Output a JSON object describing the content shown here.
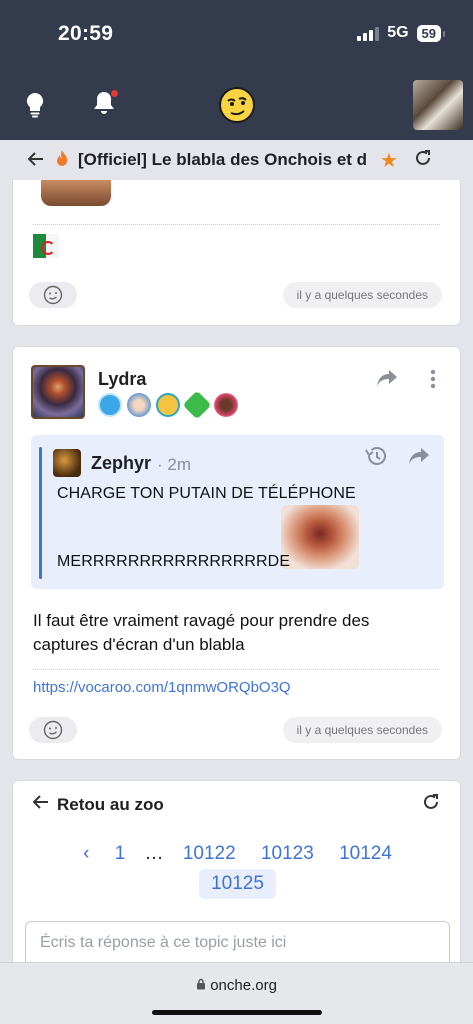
{
  "status_bar": {
    "time": "20:59",
    "network": "5G",
    "battery": "59"
  },
  "topic": {
    "title": "[Officiel] Le blabla des Onchois et d"
  },
  "posts": [
    {
      "timestamp": "il y a quelques secondes"
    },
    {
      "author": "Lydra",
      "quote": {
        "author": "Zephyr",
        "time": "· 2m",
        "line1": "CHARGE TON PUTAIN DE TÉLÉPHONE",
        "line2": "MERRRRRRRRRRRRRRRRDE"
      },
      "body": "Il faut être vraiment ravagé pour prendre des captures d'écran d'un blabla",
      "link": "https://vocaroo.com/1qnmwORQbO3Q",
      "timestamp": "il y a quelques secondes"
    }
  ],
  "navigation": {
    "back_label": "Retou au zoo",
    "pages": [
      "1",
      "…",
      "10122",
      "10123",
      "10124"
    ],
    "current_page": "10125",
    "prev_symbol": "‹"
  },
  "reply": {
    "placeholder": "Écris ta réponse à ce topic juste ici"
  },
  "browser": {
    "url": "onche.org"
  },
  "colors": {
    "header": "#343b4c",
    "accent": "#3f74d6",
    "star": "#f08a1f",
    "quote_bg": "#e8eefb"
  }
}
